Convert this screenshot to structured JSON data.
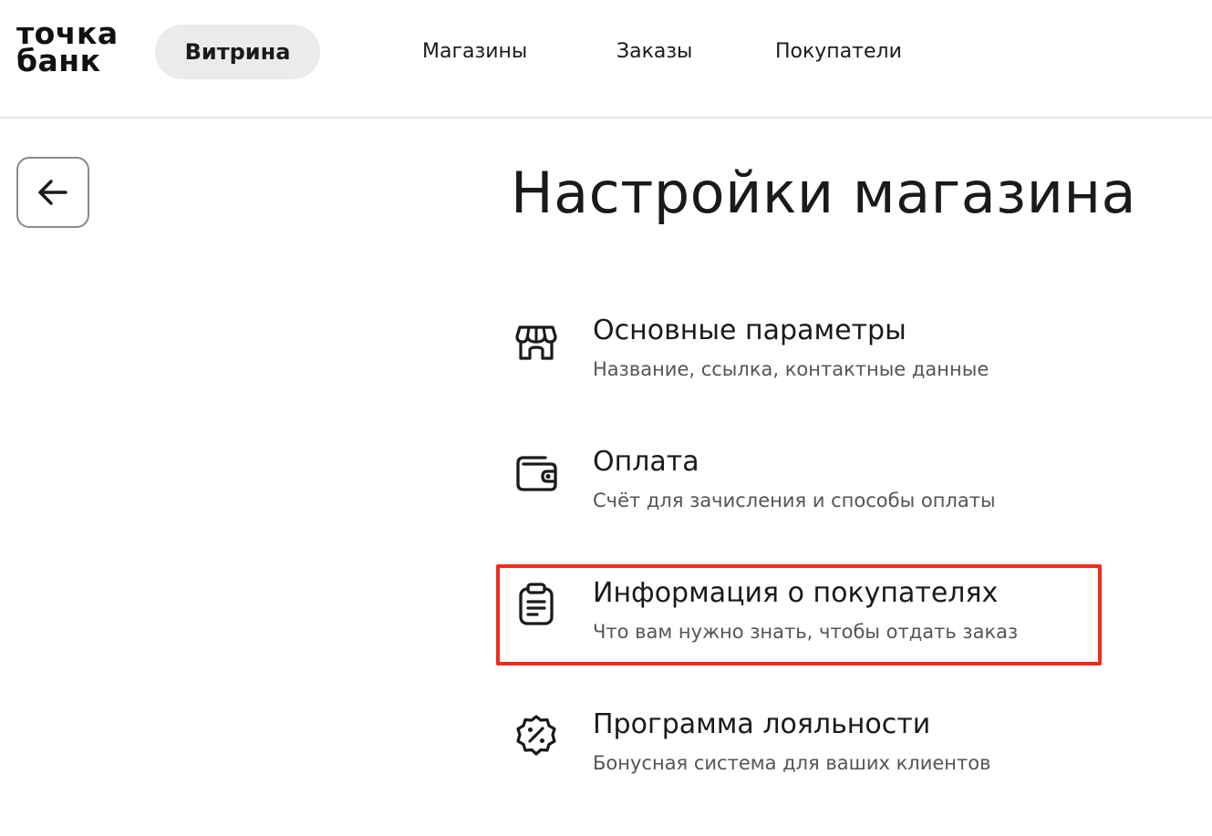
{
  "header": {
    "logo_line1": "точка",
    "logo_line2": "банк",
    "active_tab": "Витрина",
    "nav": [
      "Магазины",
      "Заказы",
      "Покупатели"
    ]
  },
  "page": {
    "title": "Настройки магазина"
  },
  "settings": [
    {
      "title": "Основные параметры",
      "subtitle": "Название, ссылка, контактные данные",
      "icon": "store-icon"
    },
    {
      "title": "Оплата",
      "subtitle": "Счёт для зачисления и способы оплаты",
      "icon": "wallet-icon"
    },
    {
      "title": "Информация о покупателях",
      "subtitle": "Что вам нужно знать, чтобы отдать заказ",
      "icon": "clipboard-icon",
      "highlighted": true
    },
    {
      "title": "Программа лояльности",
      "subtitle": "Бонусная система для ваших клиентов",
      "icon": "discount-badge-icon"
    }
  ],
  "colors": {
    "highlight": "#f02c1f",
    "pill_bg": "#ebebeb",
    "text": "#1a1a1a",
    "muted": "#555555"
  }
}
